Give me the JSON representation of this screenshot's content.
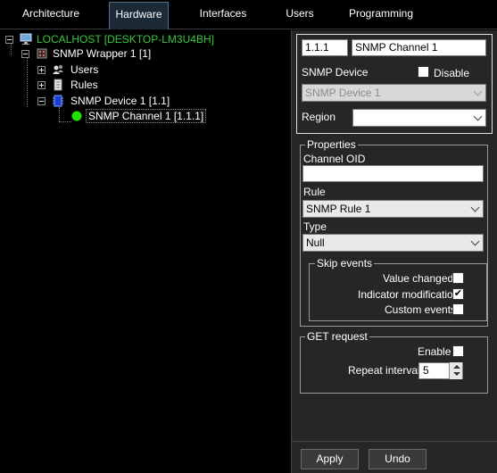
{
  "tabs": [
    "Architecture",
    "Hardware",
    "Interfaces",
    "Users",
    "Programming"
  ],
  "active_tab": "Hardware",
  "tree": {
    "root": "LOCALHOST [DESKTOP-LM3U4BH]",
    "wrapper": "SNMP Wrapper 1 [1]",
    "users": "Users",
    "rules": "Rules",
    "device": "SNMP Device 1 [1.1]",
    "channel": "SNMP Channel 1 [1.1.1]"
  },
  "header": {
    "id_value": "1.1.1",
    "name_value": "SNMP Channel 1"
  },
  "device": {
    "label": "SNMP Device",
    "disable_label": "Disable",
    "disable_checked": false,
    "selected": "SNMP Device 1"
  },
  "region": {
    "label": "Region",
    "selected": ""
  },
  "properties": {
    "legend": "Properties",
    "oid_label": "Channel OID",
    "oid_value": "",
    "rule_label": "Rule",
    "rule_selected": "SNMP Rule 1",
    "type_label": "Type",
    "type_selected": "Null"
  },
  "skip_events": {
    "legend": "Skip events",
    "value_changed": "Value changed",
    "value_changed_checked": false,
    "indicator_modification": "Indicator modification",
    "indicator_modification_checked": true,
    "custom_events": "Custom events",
    "custom_events_checked": false
  },
  "get_request": {
    "legend": "GET request",
    "enable_label": "Enable",
    "enable_checked": false,
    "interval_label": "Repeat interval",
    "interval_value": "5"
  },
  "buttons": {
    "apply": "Apply",
    "undo": "Undo"
  },
  "colors": {
    "root_text": "#3cc83c",
    "status_green": "#22e000",
    "active_tab_bg": "#1c2a36",
    "panel_bg": "#262626"
  }
}
